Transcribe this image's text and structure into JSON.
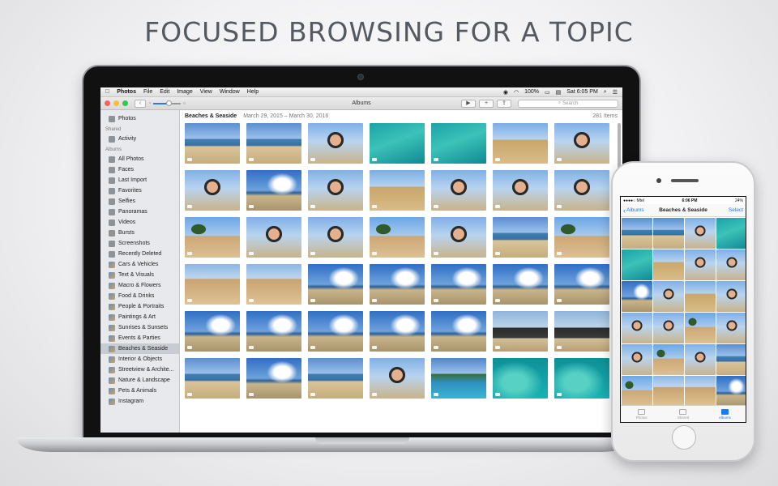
{
  "headline": "FOCUSED BROWSING FOR A TOPIC",
  "colors": {
    "accent": "#1a7cf5",
    "close": "#fc605c",
    "minimize": "#fdbc40",
    "zoom": "#34c84a"
  },
  "menubar": {
    "apple_icon": "apple-logo-icon",
    "items": [
      "Photos",
      "File",
      "Edit",
      "Image",
      "View",
      "Window",
      "Help"
    ],
    "battery": "100%",
    "clock": "Sat 6:05 PM"
  },
  "toolbar": {
    "window_title": "Albums",
    "back_glyph": "‹",
    "zoom_slider_level": 0.55,
    "play_glyph": "▶",
    "add_glyph": "+",
    "share_glyph": "⇪",
    "search_placeholder": "Search"
  },
  "sidebar": {
    "top_items": [
      {
        "label": "Photos",
        "icon": "photos-icon"
      }
    ],
    "shared_heading": "Shared",
    "shared_items": [
      {
        "label": "Activity",
        "icon": "activity-cloud-icon"
      }
    ],
    "albums_heading": "Albums",
    "album_items": [
      {
        "label": "All Photos",
        "icon": "all-photos-icon"
      },
      {
        "label": "Faces",
        "icon": "faces-icon"
      },
      {
        "label": "Last Import",
        "icon": "last-import-icon"
      },
      {
        "label": "Favorites",
        "icon": "favorites-heart-icon"
      },
      {
        "label": "Selfies",
        "icon": "selfies-icon"
      },
      {
        "label": "Panoramas",
        "icon": "panoramas-icon"
      },
      {
        "label": "Videos",
        "icon": "videos-icon"
      },
      {
        "label": "Bursts",
        "icon": "bursts-icon"
      },
      {
        "label": "Screenshots",
        "icon": "screenshots-icon"
      },
      {
        "label": "Recently Deleted",
        "icon": "trash-icon"
      },
      {
        "label": "Cars & Vehicles",
        "icon": "album-thumbnail-icon"
      },
      {
        "label": "Text & Visuals",
        "icon": "album-thumbnail-icon"
      },
      {
        "label": "Macro & Flowers",
        "icon": "album-thumbnail-icon"
      },
      {
        "label": "Food & Drinks",
        "icon": "album-thumbnail-icon"
      },
      {
        "label": "People & Portraits",
        "icon": "album-thumbnail-icon"
      },
      {
        "label": "Paintings & Art",
        "icon": "album-thumbnail-icon"
      },
      {
        "label": "Sunrises & Sunsets",
        "icon": "album-thumbnail-icon"
      },
      {
        "label": "Events & Parties",
        "icon": "album-thumbnail-icon"
      },
      {
        "label": "Beaches & Seaside",
        "icon": "album-thumbnail-icon",
        "selected": true
      },
      {
        "label": "Interior & Objects",
        "icon": "album-thumbnail-icon"
      },
      {
        "label": "Streetview & Archite...",
        "icon": "album-thumbnail-icon"
      },
      {
        "label": "Nature & Landscape",
        "icon": "album-thumbnail-icon"
      },
      {
        "label": "Pets & Animals",
        "icon": "album-thumbnail-icon"
      },
      {
        "label": "Instagram",
        "icon": "album-thumbnail-icon"
      }
    ]
  },
  "content": {
    "album_title": "Beaches & Seaside",
    "date_range": "March 29, 2015 – March 30, 2016",
    "item_count": "281 Items",
    "photos": [
      "beach",
      "beach",
      "selfie",
      "sea",
      "sea",
      "desert",
      "selfie",
      "selfie",
      "sky",
      "selfie",
      "desert",
      "selfie",
      "selfie",
      "selfie",
      "palm",
      "selfie",
      "selfie",
      "palm",
      "selfie",
      "beach",
      "palm",
      "wall",
      "wall",
      "sky",
      "sky",
      "sky",
      "sky",
      "sky",
      "sky",
      "sky",
      "sky",
      "sky",
      "sky",
      "laptop",
      "laptop",
      "beach",
      "sky",
      "beach",
      "selfie",
      "pool",
      "water",
      "water"
    ]
  },
  "phone": {
    "status_carrier": "●●●●○ Mtel",
    "status_time": "6:06 PM",
    "status_battery": "24%",
    "back_label": "Albums",
    "title": "Beaches & Seaside",
    "select_label": "Select",
    "photos": [
      "beach",
      "beach",
      "selfie",
      "sea",
      "sea",
      "desert",
      "selfie",
      "selfie",
      "sky",
      "selfie",
      "desert",
      "selfie",
      "selfie",
      "selfie",
      "palm",
      "selfie",
      "selfie",
      "palm",
      "selfie",
      "beach",
      "palm",
      "wall",
      "wall",
      "sky"
    ],
    "tabs": [
      {
        "label": "Photos",
        "icon": "photos-tab-icon",
        "active": false
      },
      {
        "label": "Shared",
        "icon": "shared-cloud-icon",
        "active": false
      },
      {
        "label": "Albums",
        "icon": "albums-tab-icon",
        "active": true
      }
    ]
  }
}
